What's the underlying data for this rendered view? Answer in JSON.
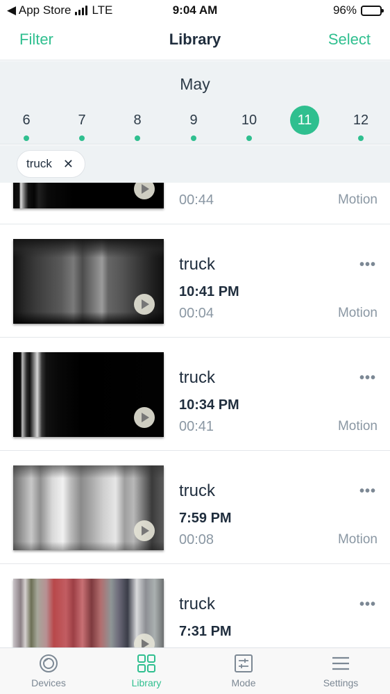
{
  "status_bar": {
    "back_app": "◀ App Store",
    "network": "LTE",
    "time": "9:04 AM",
    "battery": "96%",
    "battery_level": 0.96
  },
  "nav": {
    "left_label": "Filter",
    "title": "Library",
    "right_label": "Select"
  },
  "calendar": {
    "month": "May",
    "days": [
      {
        "label": "6",
        "has_events": true,
        "selected": false
      },
      {
        "label": "7",
        "has_events": true,
        "selected": false
      },
      {
        "label": "8",
        "has_events": true,
        "selected": false
      },
      {
        "label": "9",
        "has_events": true,
        "selected": false
      },
      {
        "label": "10",
        "has_events": true,
        "selected": false
      },
      {
        "label": "11",
        "has_events": false,
        "selected": true
      },
      {
        "label": "12",
        "has_events": true,
        "selected": false
      }
    ]
  },
  "filter_chips": [
    {
      "label": "truck",
      "remove_icon": "close-icon"
    }
  ],
  "recordings": [
    {
      "label": "",
      "time": "",
      "duration": "00:44",
      "type": "Motion",
      "more": "",
      "thumb_style": "dark-streaks"
    },
    {
      "label": "truck",
      "time": "10:41 PM",
      "duration": "00:04",
      "type": "Motion",
      "more": "•••",
      "thumb_style": "gray-tank"
    },
    {
      "label": "truck",
      "time": "10:34 PM",
      "duration": "00:41",
      "type": "Motion",
      "more": "•••",
      "thumb_style": "dark-streaks"
    },
    {
      "label": "truck",
      "time": "7:59 PM",
      "duration": "00:08",
      "type": "Motion",
      "more": "•••",
      "thumb_style": "light-gray"
    },
    {
      "label": "truck",
      "time": "7:31 PM",
      "duration": "",
      "type": "",
      "more": "•••",
      "thumb_style": "color-streaks"
    }
  ],
  "tabs": [
    {
      "label": "Devices",
      "icon": "devices-icon",
      "active": false
    },
    {
      "label": "Library",
      "icon": "grid-icon",
      "active": true
    },
    {
      "label": "Mode",
      "icon": "sliders-icon",
      "active": false
    },
    {
      "label": "Settings",
      "icon": "menu-icon",
      "active": false
    }
  ],
  "colors": {
    "accent": "#2fbf8f",
    "text_primary": "#1f2d3d",
    "text_secondary": "#8a97a3",
    "header_bg": "#eef2f4"
  }
}
